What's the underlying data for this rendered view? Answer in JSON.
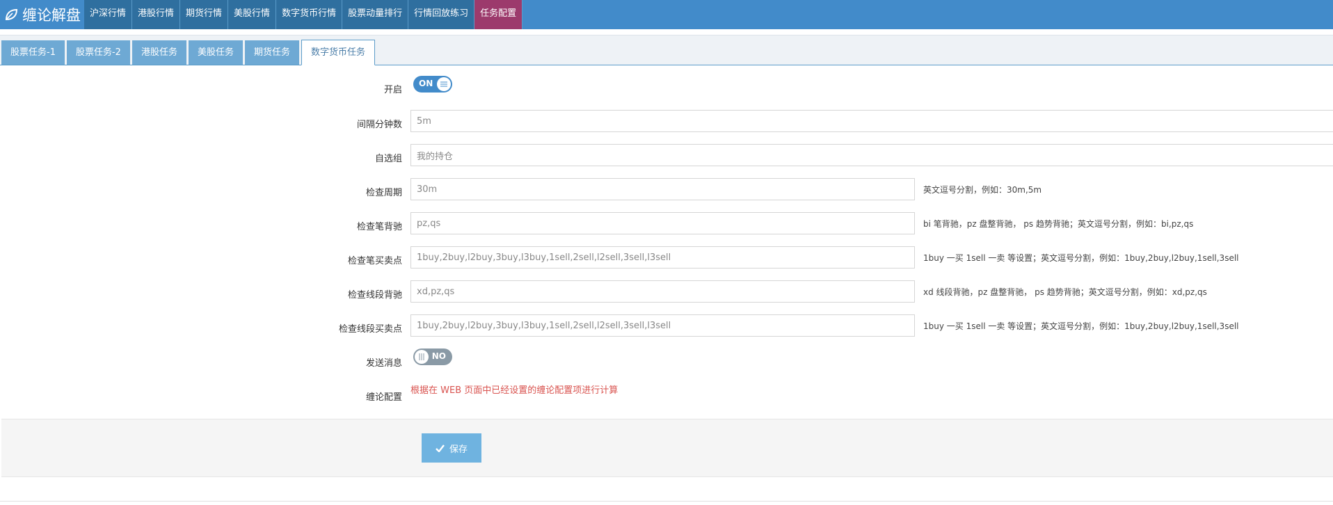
{
  "brand": {
    "title": "缠论解盘",
    "icon": "leaf-icon"
  },
  "nav": {
    "items": [
      {
        "label": "沪深行情"
      },
      {
        "label": "港股行情"
      },
      {
        "label": "期货行情"
      },
      {
        "label": "美股行情"
      },
      {
        "label": "数字货币行情"
      },
      {
        "label": "股票动量排行"
      },
      {
        "label": "行情回放练习"
      },
      {
        "label": "任务配置"
      }
    ],
    "active_index": 7
  },
  "tabs": {
    "items": [
      {
        "label": "股票任务-1"
      },
      {
        "label": "股票任务-2"
      },
      {
        "label": "港股任务"
      },
      {
        "label": "美股任务"
      },
      {
        "label": "期货任务"
      },
      {
        "label": "数字货币任务"
      }
    ],
    "active_index": 5
  },
  "form": {
    "enable": {
      "label": "开启",
      "state": "ON"
    },
    "interval": {
      "label": "间隔分钟数",
      "value": "5m"
    },
    "watchlist": {
      "label": "自选组",
      "value": "我的持仓"
    },
    "period": {
      "label": "检查周期",
      "value": "30m",
      "help": "英文逗号分割，例如：30m,5m"
    },
    "bi_divergence": {
      "label": "检查笔背驰",
      "value": "pz,qs",
      "help": "bi 笔背驰，pz 盘整背驰， ps 趋势背驰；英文逗号分割，例如：bi,pz,qs"
    },
    "bi_points": {
      "label": "检查笔买卖点",
      "value": "1buy,2buy,l2buy,3buy,l3buy,1sell,2sell,l2sell,3sell,l3sell",
      "help": "1buy 一买 1sell 一卖 等设置；英文逗号分割，例如：1buy,2buy,l2buy,1sell,3sell"
    },
    "xd_divergence": {
      "label": "检查线段背驰",
      "value": "xd,pz,qs",
      "help": "xd 线段背驰，pz 盘整背驰， ps 趋势背驰；英文逗号分割，例如：xd,pz,qs"
    },
    "xd_points": {
      "label": "检查线段买卖点",
      "value": "1buy,2buy,l2buy,3buy,l3buy,1sell,2sell,l2sell,3sell,l3sell",
      "help": "1buy 一买 1sell 一卖 等设置；英文逗号分割，例如：1buy,2buy,l2buy,1sell,3sell"
    },
    "send_msg": {
      "label": "发送消息",
      "state": "NO"
    },
    "chanlun_cfg": {
      "label": "缠论配置",
      "note": "根据在 WEB 页面中已经设置的缠论配置项进行计算"
    }
  },
  "actions": {
    "save_label": "保存"
  },
  "colors": {
    "nav_bg": "#428bca",
    "nav_item_bg": "#2f6f9f",
    "nav_active": "#9c3a6c",
    "tab_bg": "#6ea9d4",
    "note_red": "#d9534f",
    "save_bg": "#6fb3e0"
  }
}
